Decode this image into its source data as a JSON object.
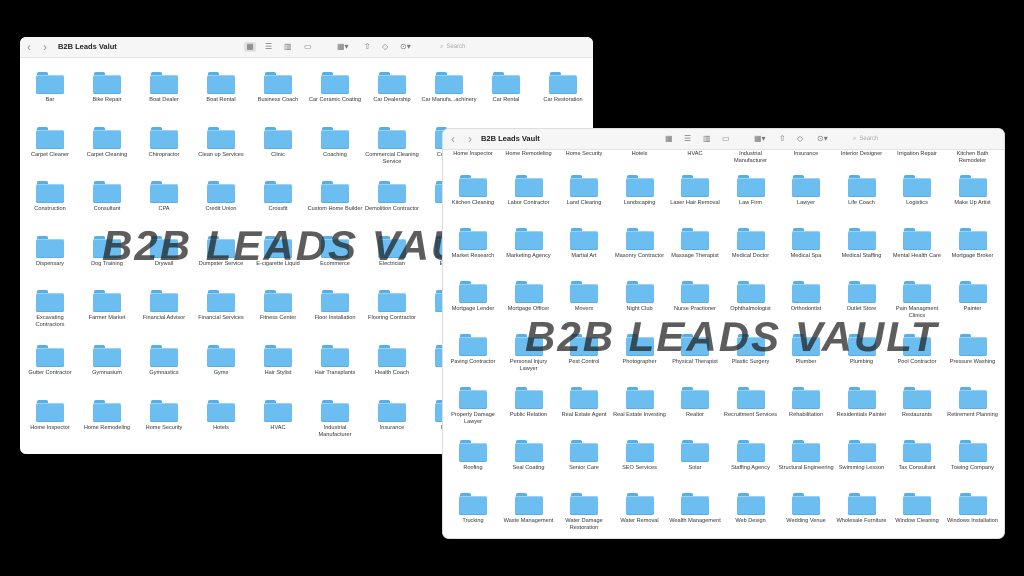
{
  "watermark": "B2B LEADS VAULT",
  "window1": {
    "title": "B2B Leads Valut",
    "search_placeholder": "Search",
    "folders": [
      "Bar",
      "Bike Repair",
      "Boat Dealer",
      "Boat Rental",
      "Business Coach",
      "Car Ceramic Coating",
      "Car Dealership",
      "Car Manufa...achinery",
      "Car Rental",
      "Car Restoration",
      "Carpet Cleaner",
      "Carpet Cleaning",
      "Chiropractor",
      "Clean up Services",
      "Clinic",
      "Coaching",
      "Commercial Cleaning Service",
      "Co... Sc...",
      "",
      "",
      "Construction",
      "Consultant",
      "CPA",
      "Credit Union",
      "Crossfit",
      "Custom Home Builder",
      "Demolition Contractor",
      "D...",
      "",
      "",
      "Dispensary",
      "Dog Training",
      "Drywall",
      "Dumpster Service",
      "E-cigarette Liquid",
      "Ecommerce",
      "Electrician",
      "Email...",
      "",
      "",
      "Excavating Contractors",
      "Farmer Market",
      "Financial Advisor",
      "Financial Services",
      "Fitness Center",
      "Floor Installation",
      "Flooring Contractor",
      "Ma...",
      "",
      "",
      "Gutter Contractor",
      "Gymnasium",
      "Gymnastics",
      "Gyms",
      "Hair Stylist",
      "Hair Transplants",
      "Health Coach",
      "He...",
      "",
      "",
      "Home Inspector",
      "Home Remodeling",
      "Home Security",
      "Hotels",
      "HVAC",
      "Industrial Manufacturer",
      "Insurance",
      "Interi...",
      "",
      ""
    ]
  },
  "window2": {
    "title": "B2B Leads Vault",
    "search_placeholder": "Search",
    "top_labels": [
      "Home Inspector",
      "Home Remodeling",
      "Home Security",
      "Hotels",
      "HVAC",
      "Industrial Manufacturer",
      "Insurance",
      "Interior Designer",
      "Irrigation Repair",
      "Kitchen Bath Remodeler"
    ],
    "folders": [
      "Kitchen Cleaning",
      "Labor Contractor",
      "Land Clearing",
      "Landscaping",
      "Laser Hair Removal",
      "Law Firm",
      "Lawyer",
      "Life Coach",
      "Logistics",
      "Make Up Artist",
      "Market Research",
      "Marketing Agency",
      "Martial Art",
      "Masonry Contractor",
      "Massage Therapist",
      "Medical Doctor",
      "Medical Spa",
      "Medical Staffing",
      "Mental Health Care",
      "Mortgage Broker",
      "Mortgage Lender",
      "Mortgage Officer",
      "Movers",
      "Night Club",
      "Nurse Practioner",
      "Ophthalmologist",
      "Orthodontist",
      "Outlet Store",
      "Pain Managment Clinics",
      "Painter",
      "Paving Contractor",
      "Personal Injury Lawyer",
      "Pest Control",
      "Photographer",
      "Physical Therapist",
      "Plastic Surgery",
      "Plumber",
      "Plumbing",
      "Pool Contractor",
      "Pressure Washing",
      "Property Damage Lawyer",
      "Public Relation",
      "Real Estate Agent",
      "Real Estate Investing",
      "Realtor",
      "Recruitment Services",
      "Rehabilitation",
      "Residentials Painter",
      "Restaurants",
      "Retirement Planning",
      "Roofing",
      "Seal Coating",
      "Senior Care",
      "SEO Services",
      "Solar",
      "Staffing Agency",
      "Structural Engineering",
      "Swimming Lesson",
      "Tax Consultant",
      "Towing Company",
      "Trucking",
      "Waste Management",
      "Water Damage Restoration",
      "Water Removal",
      "Wealth Management",
      "Web Design",
      "Wedding Venue",
      "Wholesale Furniture",
      "Window Cleaning",
      "Windows Installation"
    ]
  }
}
